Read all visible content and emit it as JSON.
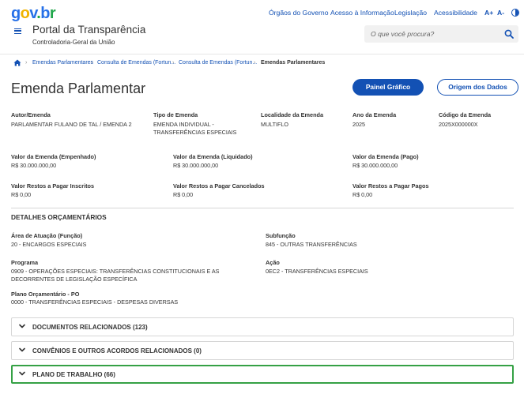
{
  "header": {
    "logo": {
      "g": "g",
      "o": "o",
      "v": "v",
      "dot": ".",
      "b": "b",
      "r": "r"
    },
    "links": [
      "Órgãos do Governo",
      "Acesso à Informação",
      "Legislação",
      "Acessibilidade"
    ],
    "font_increase": "A+",
    "font_decrease": "A-",
    "title": "Portal da Transparência",
    "subtitle": "Controladoria-Geral da União",
    "search_placeholder": "O que você procura?"
  },
  "breadcrumb": [
    "Emendas Parlamentares",
    "Consulta de Emendas (Fortun...",
    "Consulta de Emendas (Fortun...",
    "Emendas Parlamentares"
  ],
  "page": {
    "title": "Emenda Parlamentar",
    "btn_painel": "Painel Gráfico",
    "btn_origem": "Origem dos Dados"
  },
  "fields": {
    "autor": {
      "label": "Autor/Emenda",
      "value": "PARLAMENTAR FULANO DE TAL / EMENDA 2"
    },
    "tipo": {
      "label": "Tipo de Emenda",
      "value": "EMENDA INDIVIDUAL - TRANSFERÊNCIAS ESPECIAIS"
    },
    "localidade": {
      "label": "Localidade da Emenda",
      "value": "MULTIFLO"
    },
    "ano": {
      "label": "Ano da Emenda",
      "value": "2025"
    },
    "codigo": {
      "label": "Código da Emenda",
      "value": "2025X000000X"
    },
    "valor_empenhado": {
      "label": "Valor da Emenda (Empenhado)",
      "value": "R$ 30.000.000,00"
    },
    "valor_liquidado": {
      "label": "Valor da Emenda (Liquidado)",
      "value": "R$ 30.000.000,00"
    },
    "valor_pago": {
      "label": "Valor da Emenda (Pago)",
      "value": "R$ 30.000.000,00"
    },
    "restos_inscritos": {
      "label": "Valor Restos a Pagar Inscritos",
      "value": "R$ 0,00"
    },
    "restos_cancelados": {
      "label": "Valor Restos a Pagar Cancelados",
      "value": "R$ 0,00"
    },
    "restos_pagos": {
      "label": "Valor Restos a Pagar Pagos",
      "value": "R$ 0,00"
    }
  },
  "detalhes": {
    "title": "DETALHES ORÇAMENTÁRIOS",
    "area": {
      "label": "Área de Atuação (Função)",
      "value": "20 - ENCARGOS ESPECIAIS"
    },
    "subfuncao": {
      "label": "Subfunção",
      "value": "845 - OUTRAS TRANSFERÊNCIAS"
    },
    "programa": {
      "label": "Programa",
      "value": "0909 - OPERAÇÕES ESPECIAIS: TRANSFERÊNCIAS CONSTITUCIONAIS E AS DECORRENTES DE LEGISLAÇÃO ESPECÍFICA"
    },
    "acao": {
      "label": "Ação",
      "value": "0EC2 - TRANSFERÊNCIAS ESPECIAIS"
    },
    "plano": {
      "label": "Plano Orçamentário - PO",
      "value": "0000 - TRANSFERÊNCIAS ESPECIAIS - DESPESAS DIVERSAS"
    }
  },
  "accordions": [
    {
      "label": "DOCUMENTOS RELACIONADOS (123)",
      "active": false
    },
    {
      "label": "CONVÊNIOS E OUTROS ACORDOS RELACIONADOS (0)",
      "active": false
    },
    {
      "label": "PLANO DE TRABALHO (66)",
      "active": true
    }
  ],
  "colors": {
    "primary": "#1351b4",
    "active_border": "#35a145"
  }
}
